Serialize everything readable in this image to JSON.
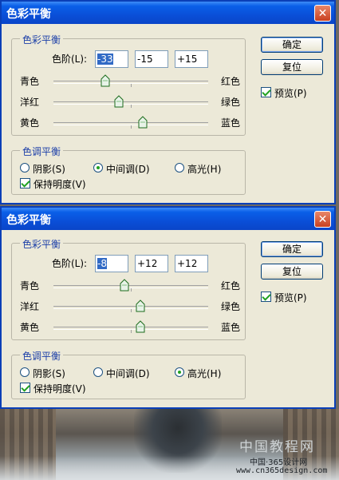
{
  "dialogs": [
    {
      "title": "色彩平衡",
      "close_glyph": "✕",
      "balance_group_label": "色彩平衡",
      "levels_label": "色阶(L):",
      "levels": [
        "-33",
        "-15",
        "+15"
      ],
      "sliders": [
        {
          "left": "青色",
          "right": "红色",
          "value": -33
        },
        {
          "left": "洋红",
          "right": "绿色",
          "value": -15
        },
        {
          "left": "黄色",
          "right": "蓝色",
          "value": 15
        }
      ],
      "tone_group_label": "色调平衡",
      "tones": [
        {
          "label": "阴影(S)",
          "selected": false
        },
        {
          "label": "中间调(D)",
          "selected": true
        },
        {
          "label": "高光(H)",
          "selected": false
        }
      ],
      "preserve_label": "保持明度(V)",
      "preserve_checked": true,
      "ok_label": "确定",
      "reset_label": "复位",
      "preview_label": "预览(P)",
      "preview_checked": true
    },
    {
      "title": "色彩平衡",
      "close_glyph": "✕",
      "balance_group_label": "色彩平衡",
      "levels_label": "色阶(L):",
      "levels": [
        "-8",
        "+12",
        "+12"
      ],
      "sliders": [
        {
          "left": "青色",
          "right": "红色",
          "value": -8
        },
        {
          "left": "洋红",
          "right": "绿色",
          "value": 12
        },
        {
          "left": "黄色",
          "right": "蓝色",
          "value": 12
        }
      ],
      "tone_group_label": "色调平衡",
      "tones": [
        {
          "label": "阴影(S)",
          "selected": false
        },
        {
          "label": "中间调(D)",
          "selected": false
        },
        {
          "label": "高光(H)",
          "selected": true
        }
      ],
      "preserve_label": "保持明度(V)",
      "preserve_checked": true,
      "ok_label": "确定",
      "reset_label": "复位",
      "preview_label": "预览(P)",
      "preview_checked": true
    }
  ],
  "watermark": {
    "line1": "中国教程网",
    "line2": "中国·365设计网",
    "line3": "www.cn365design.com"
  }
}
